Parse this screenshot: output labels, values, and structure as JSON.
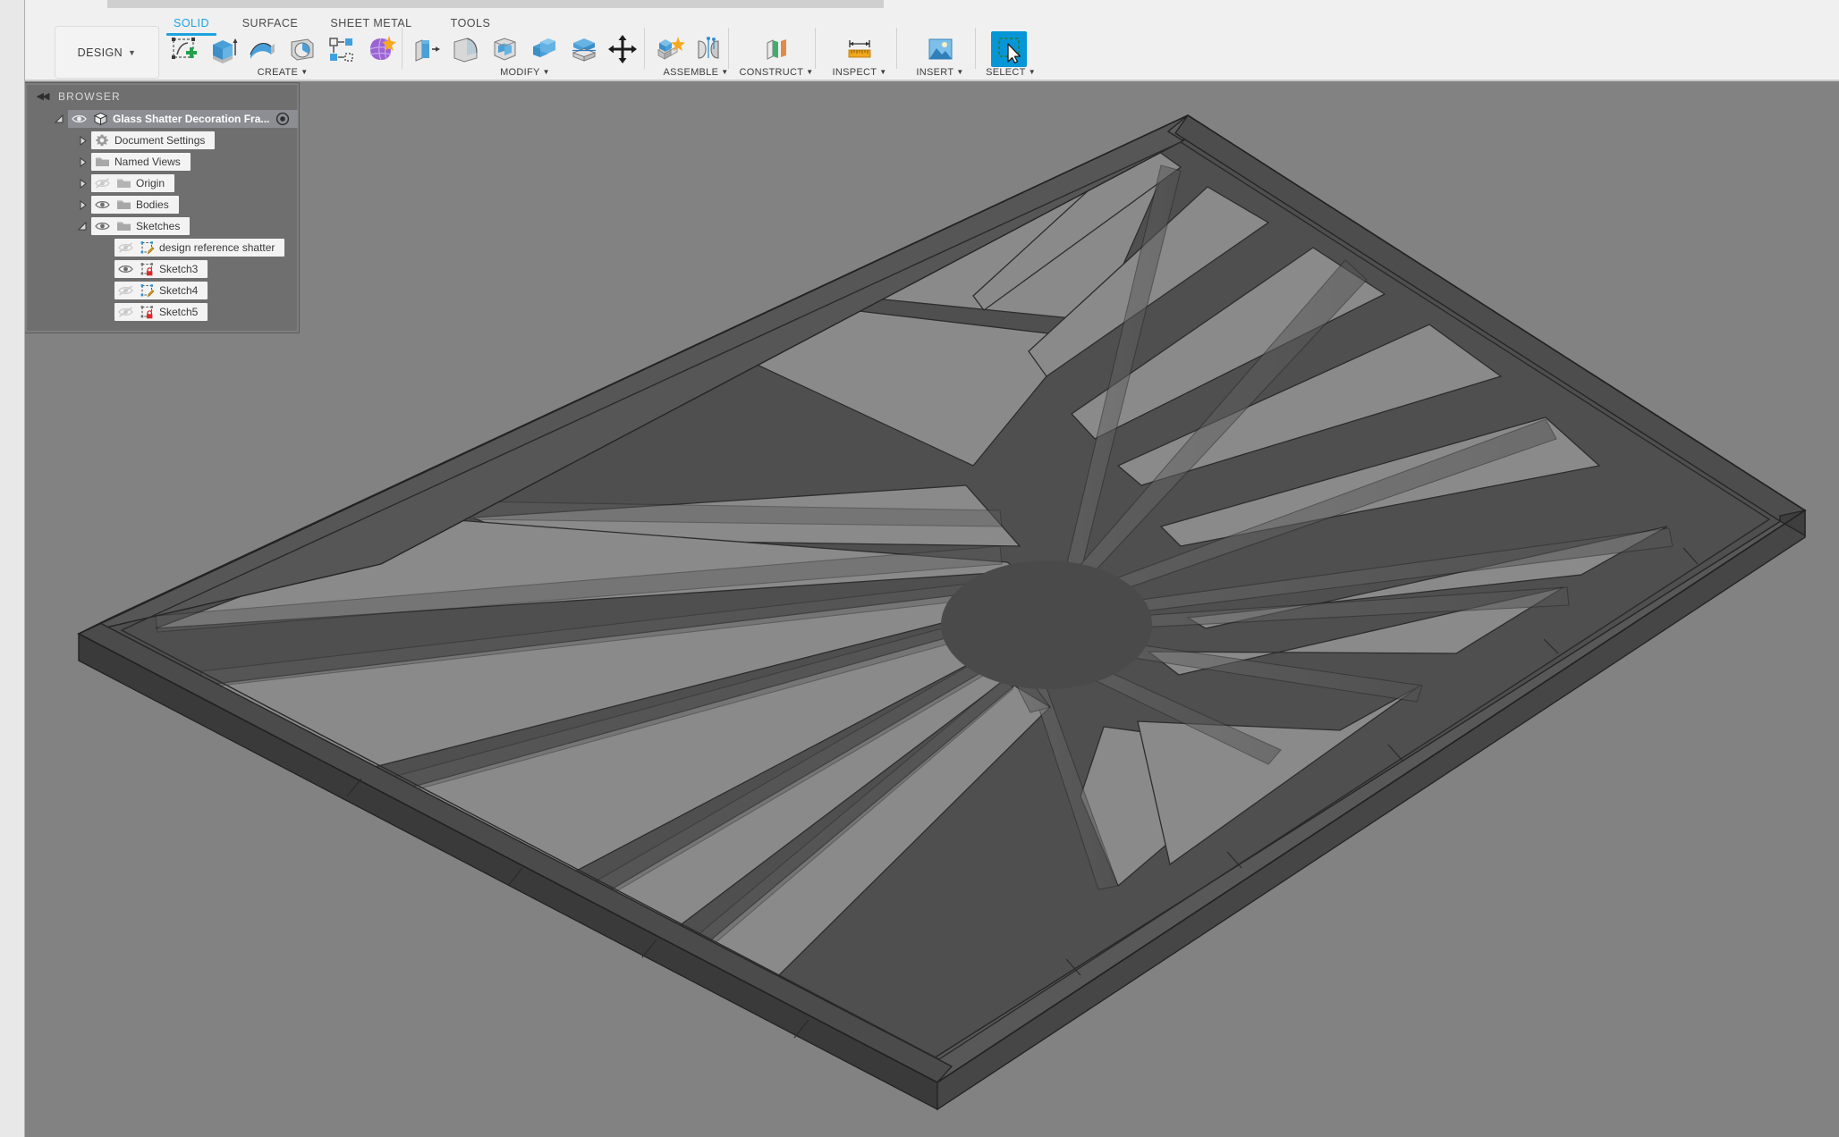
{
  "app": {
    "workspace_button": "DESIGN",
    "tabs": [
      {
        "label": "SOLID",
        "active": true
      },
      {
        "label": "SURFACE",
        "active": false
      },
      {
        "label": "SHEET METAL",
        "active": false
      },
      {
        "label": "TOOLS",
        "active": false
      }
    ]
  },
  "ribbon": {
    "groups": [
      {
        "label": "CREATE",
        "has_caret": true,
        "icons": [
          "create-sketch-icon",
          "extrude-icon",
          "revolve-icon",
          "sweep-icon",
          "pattern-rectangular-icon",
          "form-icon"
        ]
      },
      {
        "label": "MODIFY",
        "has_caret": true,
        "icons": [
          "press-pull-icon",
          "fillet-icon",
          "shell-icon",
          "combine-icon",
          "split-face-icon",
          "move-copy-icon"
        ]
      },
      {
        "label": "ASSEMBLE",
        "has_caret": true,
        "icons": [
          "new-component-icon",
          "joint-icon"
        ]
      },
      {
        "label": "CONSTRUCT",
        "has_caret": true,
        "icons": [
          "offset-plane-icon"
        ]
      },
      {
        "label": "INSPECT",
        "has_caret": true,
        "icons": [
          "measure-icon"
        ]
      },
      {
        "label": "INSERT",
        "has_caret": true,
        "icons": [
          "insert-image-icon"
        ]
      },
      {
        "label": "SELECT",
        "has_caret": true,
        "icons": [
          "select-window-icon"
        ]
      }
    ]
  },
  "browser": {
    "title": "BROWSER",
    "collapse_icon": "collapse-left-icon",
    "root": {
      "label": "Glass Shatter Decoration Fra...",
      "expander": "expanded",
      "visibility": "visible",
      "type_icon": "component-icon",
      "target_icon": "activate-component-icon",
      "selected": true
    },
    "items": [
      {
        "label": "Document Settings",
        "indent": 1,
        "expander": "collapsed",
        "visibility": "none",
        "type_icon": "gear-icon"
      },
      {
        "label": "Named Views",
        "indent": 1,
        "expander": "collapsed",
        "visibility": "none",
        "type_icon": "folder-icon"
      },
      {
        "label": "Origin",
        "indent": 1,
        "expander": "collapsed",
        "visibility": "hidden",
        "type_icon": "folder-icon"
      },
      {
        "label": "Bodies",
        "indent": 1,
        "expander": "collapsed",
        "visibility": "visible",
        "type_icon": "folder-icon"
      },
      {
        "label": "Sketches",
        "indent": 1,
        "expander": "expanded",
        "visibility": "visible",
        "type_icon": "folder-icon"
      },
      {
        "label": "design reference shatter",
        "indent": 2,
        "expander": "none",
        "visibility": "hidden",
        "type_icon": "sketch-unlocked-icon"
      },
      {
        "label": "Sketch3",
        "indent": 2,
        "expander": "none",
        "visibility": "visible",
        "type_icon": "sketch-locked-icon"
      },
      {
        "label": "Sketch4",
        "indent": 2,
        "expander": "none",
        "visibility": "hidden",
        "type_icon": "sketch-unlocked-icon"
      },
      {
        "label": "Sketch5",
        "indent": 2,
        "expander": "none",
        "visibility": "hidden",
        "type_icon": "sketch-locked-icon"
      }
    ]
  },
  "viewport": {
    "model_name": "glass-shatter-decoration-frame",
    "background_color": "#828282",
    "model_face_dark": "#4b4b4b",
    "model_face_mid": "#565656",
    "model_face_light": "#6b6b6b",
    "edge_color": "#2a2a2a"
  },
  "colors": {
    "accent": "#1aa3e0",
    "select_button": "#0696d7",
    "ribbon_bg": "#f0f0f0",
    "panel_bg": "#6f6f6f",
    "node_bg": "#f3f3f3",
    "root_node_bg": "#8d8d94"
  }
}
